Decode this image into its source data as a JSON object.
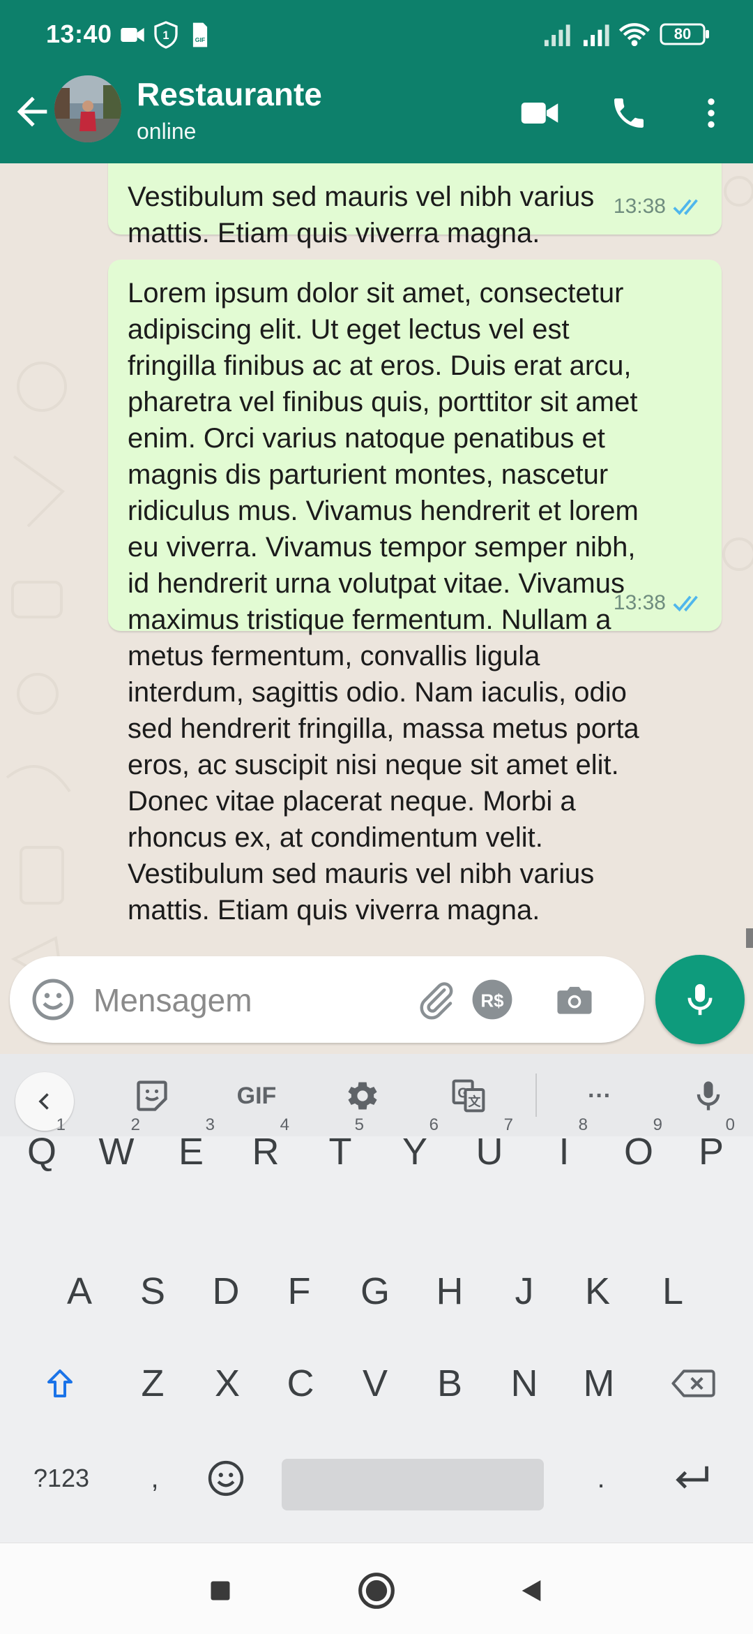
{
  "status_bar": {
    "time": "13:40",
    "battery": "80",
    "icons": [
      "video-call-icon",
      "shield-1-icon",
      "gif-file-icon",
      "signal-icon",
      "signal-icon",
      "wifi-icon",
      "battery-icon"
    ]
  },
  "header": {
    "title": "Restaurante",
    "subtitle": "online",
    "colors": {
      "bar": "#0d806b"
    }
  },
  "messages": [
    {
      "text": "Vestibulum sed mauris vel nibh varius\nmattis. Etiam quis viverra magna.",
      "time": "13:38",
      "status": "read"
    },
    {
      "text": "Lorem ipsum dolor sit amet, consectetur\nadipiscing elit. Ut eget lectus vel est\nfringilla finibus ac at eros. Duis erat arcu,\npharetra vel finibus quis, porttitor sit amet\nenim. Orci varius natoque penatibus et\nmagnis dis parturient montes, nascetur\nridiculus mus. Vivamus hendrerit et lorem\neu viverra. Vivamus tempor semper nibh,\nid hendrerit urna volutpat vitae. Vivamus\nmaximus tristique fermentum. Nullam a\nmetus fermentum, convallis ligula\ninterdum, sagittis odio. Nam iaculis, odio\nsed hendrerit fringilla, massa metus porta\neros, ac suscipit nisi neque sit amet elit.\nDonec vitae placerat neque. Morbi a\nrhoncus ex, at condimentum velit.\nVestibulum sed mauris vel nibh varius\nmattis. Etiam quis viverra magna.",
      "time": "13:38",
      "status": "read"
    }
  ],
  "composer": {
    "placeholder": "Mensagem",
    "value": ""
  },
  "keyboard": {
    "toolbar": {
      "gif_label": "GIF",
      "more_label": "···"
    },
    "rows": [
      [
        {
          "label": "Q",
          "hint": "1"
        },
        {
          "label": "W",
          "hint": "2"
        },
        {
          "label": "E",
          "hint": "3"
        },
        {
          "label": "R",
          "hint": "4"
        },
        {
          "label": "T",
          "hint": "5"
        },
        {
          "label": "Y",
          "hint": "6"
        },
        {
          "label": "U",
          "hint": "7"
        },
        {
          "label": "I",
          "hint": "8"
        },
        {
          "label": "O",
          "hint": "9"
        },
        {
          "label": "P",
          "hint": "0"
        }
      ],
      [
        {
          "label": "A"
        },
        {
          "label": "S"
        },
        {
          "label": "D"
        },
        {
          "label": "F"
        },
        {
          "label": "G"
        },
        {
          "label": "H"
        },
        {
          "label": "J"
        },
        {
          "label": "K"
        },
        {
          "label": "L"
        }
      ],
      [
        {
          "label": "Z"
        },
        {
          "label": "X"
        },
        {
          "label": "C"
        },
        {
          "label": "V"
        },
        {
          "label": "B"
        },
        {
          "label": "N"
        },
        {
          "label": "M"
        }
      ]
    ],
    "symbols_label": "?123",
    "comma_label": ",",
    "period_label": "."
  },
  "colors": {
    "bubble_out": "#e2fbd3",
    "read_ticks": "#4fb6ec",
    "fab": "#0e9b7c"
  }
}
